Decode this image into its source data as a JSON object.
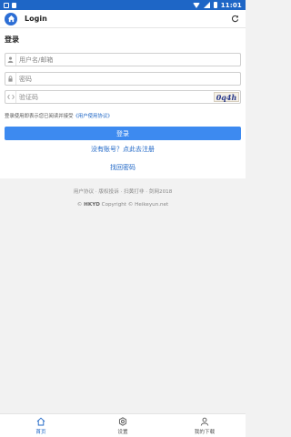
{
  "status_bar": {
    "time": "11:01"
  },
  "app_bar": {
    "title": "Login",
    "logo_icon": "home-icon",
    "refresh_icon": "refresh-icon"
  },
  "login": {
    "title": "登录",
    "username_placeholder": "用户名/邮箱",
    "password_placeholder": "密码",
    "captcha_placeholder": "验证码",
    "captcha_text": "0q4h",
    "agreement_prefix": "登录使用即表示您已阅读并接受",
    "agreement_link": "《用户使用协议》",
    "login_button": "登录",
    "register_link": "没有账号？点此去注册",
    "forgot_link": "找回密码"
  },
  "footer": {
    "links": "用户协议 · 版权投诉 · 扫黄打非 · 剑网2018",
    "copyright_symbol": "©",
    "brand": "HKYD",
    "copyright_text": "Copyright © Heikeyun.net"
  },
  "tabs": [
    {
      "label": "首页",
      "icon": "home-icon",
      "active": true
    },
    {
      "label": "设置",
      "icon": "gear-icon",
      "active": false
    },
    {
      "label": "我的下载",
      "icon": "user-icon",
      "active": false
    }
  ],
  "colors": {
    "primary": "#1e66c6",
    "button": "#3d8af0",
    "background": "#f2f2f2"
  }
}
